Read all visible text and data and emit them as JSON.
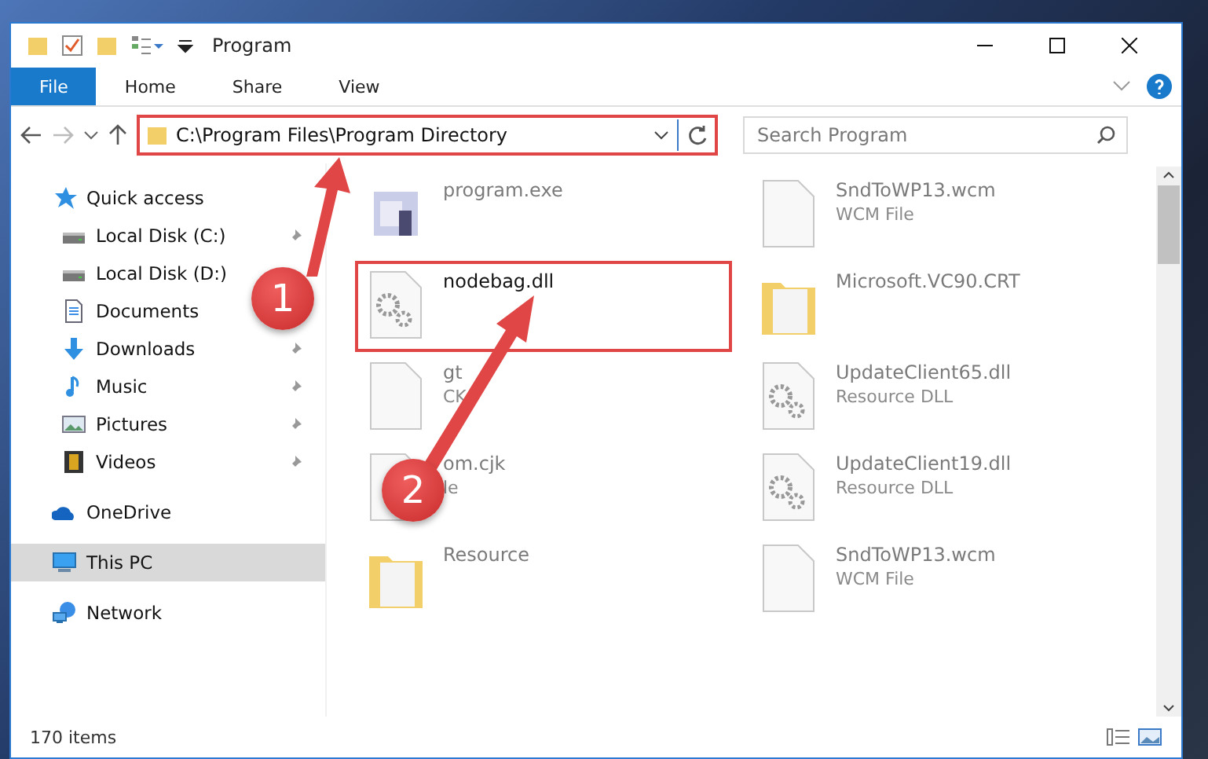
{
  "window": {
    "title": "Program"
  },
  "ribbon_tabs": [
    {
      "label": "File",
      "kind": "file",
      "selected": false
    },
    {
      "label": "Home",
      "kind": "tab",
      "selected": false
    },
    {
      "label": "Share",
      "kind": "tab",
      "selected": false
    },
    {
      "label": "View",
      "kind": "tab",
      "selected": false
    }
  ],
  "address_bar": {
    "path": "C:\\Program Files\\Program Directory",
    "highlighted": true
  },
  "search": {
    "placeholder": "Search Program"
  },
  "sidebar": {
    "items": [
      {
        "label": "Quick access",
        "kind": "star",
        "selected": false,
        "children": [
          {
            "label": "Local Disk (C:)",
            "kind": "disk",
            "pinned": true,
            "selected": false
          },
          {
            "label": "Local Disk (D:)",
            "kind": "disk",
            "pinned": false,
            "selected": false
          },
          {
            "label": "Documents",
            "kind": "document",
            "pinned": false,
            "selected": false
          },
          {
            "label": "Downloads",
            "kind": "download",
            "pinned": true,
            "selected": false
          },
          {
            "label": "Music",
            "kind": "music",
            "pinned": true,
            "selected": false
          },
          {
            "label": "Pictures",
            "kind": "pictures",
            "pinned": true,
            "selected": false
          },
          {
            "label": "Videos",
            "kind": "videos",
            "pinned": true,
            "selected": false
          }
        ]
      },
      {
        "label": "OneDrive",
        "kind": "cloud",
        "selected": false
      },
      {
        "label": "This PC",
        "kind": "pc",
        "selected": true
      },
      {
        "label": "Network",
        "kind": "network",
        "selected": false
      }
    ]
  },
  "files": [
    {
      "name": "program.exe",
      "kind": "exe",
      "blurred": true,
      "highlighted": false
    },
    {
      "name": "SndToWP13.wcm",
      "type": "WCM File",
      "kind": "blank",
      "blurred": true,
      "highlighted": false
    },
    {
      "name": "nodebag.dll",
      "kind": "dll",
      "blurred": false,
      "highlighted": true
    },
    {
      "name": "Microsoft.VC90.CRT",
      "kind": "folder",
      "blurred": true,
      "highlighted": false
    },
    {
      "name": "gt",
      "type": "CK",
      "kind": "blank",
      "blurred": true,
      "highlighted": false
    },
    {
      "name": "UpdateClient65.dll",
      "type": "Resource DLL",
      "kind": "dll",
      "blurred": true,
      "highlighted": false
    },
    {
      "name": "om.cjk",
      "type": "le",
      "kind": "blank",
      "blurred": true,
      "highlighted": false
    },
    {
      "name": "UpdateClient19.dll",
      "type": "Resource DLL",
      "kind": "dll",
      "blurred": true,
      "highlighted": false
    },
    {
      "name": "Resource",
      "kind": "folder",
      "blurred": true,
      "highlighted": false
    },
    {
      "name": "SndToWP13.wcm",
      "type": "WCM File",
      "kind": "blank",
      "blurred": true,
      "highlighted": false
    }
  ],
  "status_bar": {
    "count": "170 items"
  },
  "callouts": [
    {
      "number": "1"
    },
    {
      "number": "2"
    }
  ]
}
